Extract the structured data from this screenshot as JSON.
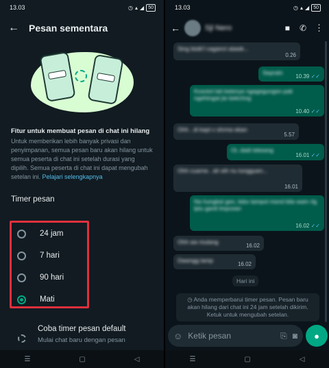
{
  "left": {
    "status_time": "13.03",
    "title": "Pesan sementara",
    "desc_title": "Fitur untuk membuat pesan di chat ini hilang",
    "desc_body": "Untuk memberikan lebih banyak privasi dan penyimpanan, semua pesan baru akan hilang untuk semua peserta di chat ini setelah durasi yang dipilih. Semua peserta di chat ini dapat mengubah setelan ini. ",
    "desc_link": "Pelajari selengkapnya",
    "section": "Timer pesan",
    "options": [
      {
        "label": "24 jam",
        "selected": false
      },
      {
        "label": "7 hari",
        "selected": false
      },
      {
        "label": "90 hari",
        "selected": false
      },
      {
        "label": "Mati",
        "selected": true
      }
    ],
    "coba_title": "Coba timer pesan default",
    "coba_sub": "Mulai chat baru dengan pesan"
  },
  "right": {
    "status_time": "13.03",
    "contact": "Sjl Nero",
    "messages": [
      {
        "dir": "in",
        "text": "Sing bisik'l caganct atawk...",
        "time": "0.26"
      },
      {
        "dir": "out",
        "text": "Sepratn",
        "time": "10.39"
      },
      {
        "dir": "out",
        "text": "Kosotol lati ketenye ngagegungen pak ngehtngat jie bekchng",
        "time": "10.40"
      },
      {
        "dir": "in",
        "text": "Ohh , di kapt v shrma ekan",
        "time": "5.57"
      },
      {
        "dir": "out",
        "text": "Oi, dadi tekeang",
        "time": "16.01"
      },
      {
        "dir": "in",
        "text": "Ohh cuarne.. ah eih nu tungguen...",
        "time": "16.01"
      },
      {
        "dir": "out",
        "text": "Na hungkal gen, lebo tampol msnd bila wam rlg lptu gantl lmpcean",
        "time": "16.02"
      },
      {
        "dir": "in",
        "text": "Ohh aw mulang",
        "time": "16.02"
      },
      {
        "dir": "in",
        "text": "Dawngg lamp",
        "time": "16.02"
      }
    ],
    "date_chip": "Hari ini",
    "system_msg": "Anda memperbarui timer pesan. Pesan baru akan hilang dari chat ini 24 jam setelah dikirim. Ketuk untuk mengubah setelan.",
    "composer_placeholder": "Ketik pesan"
  }
}
